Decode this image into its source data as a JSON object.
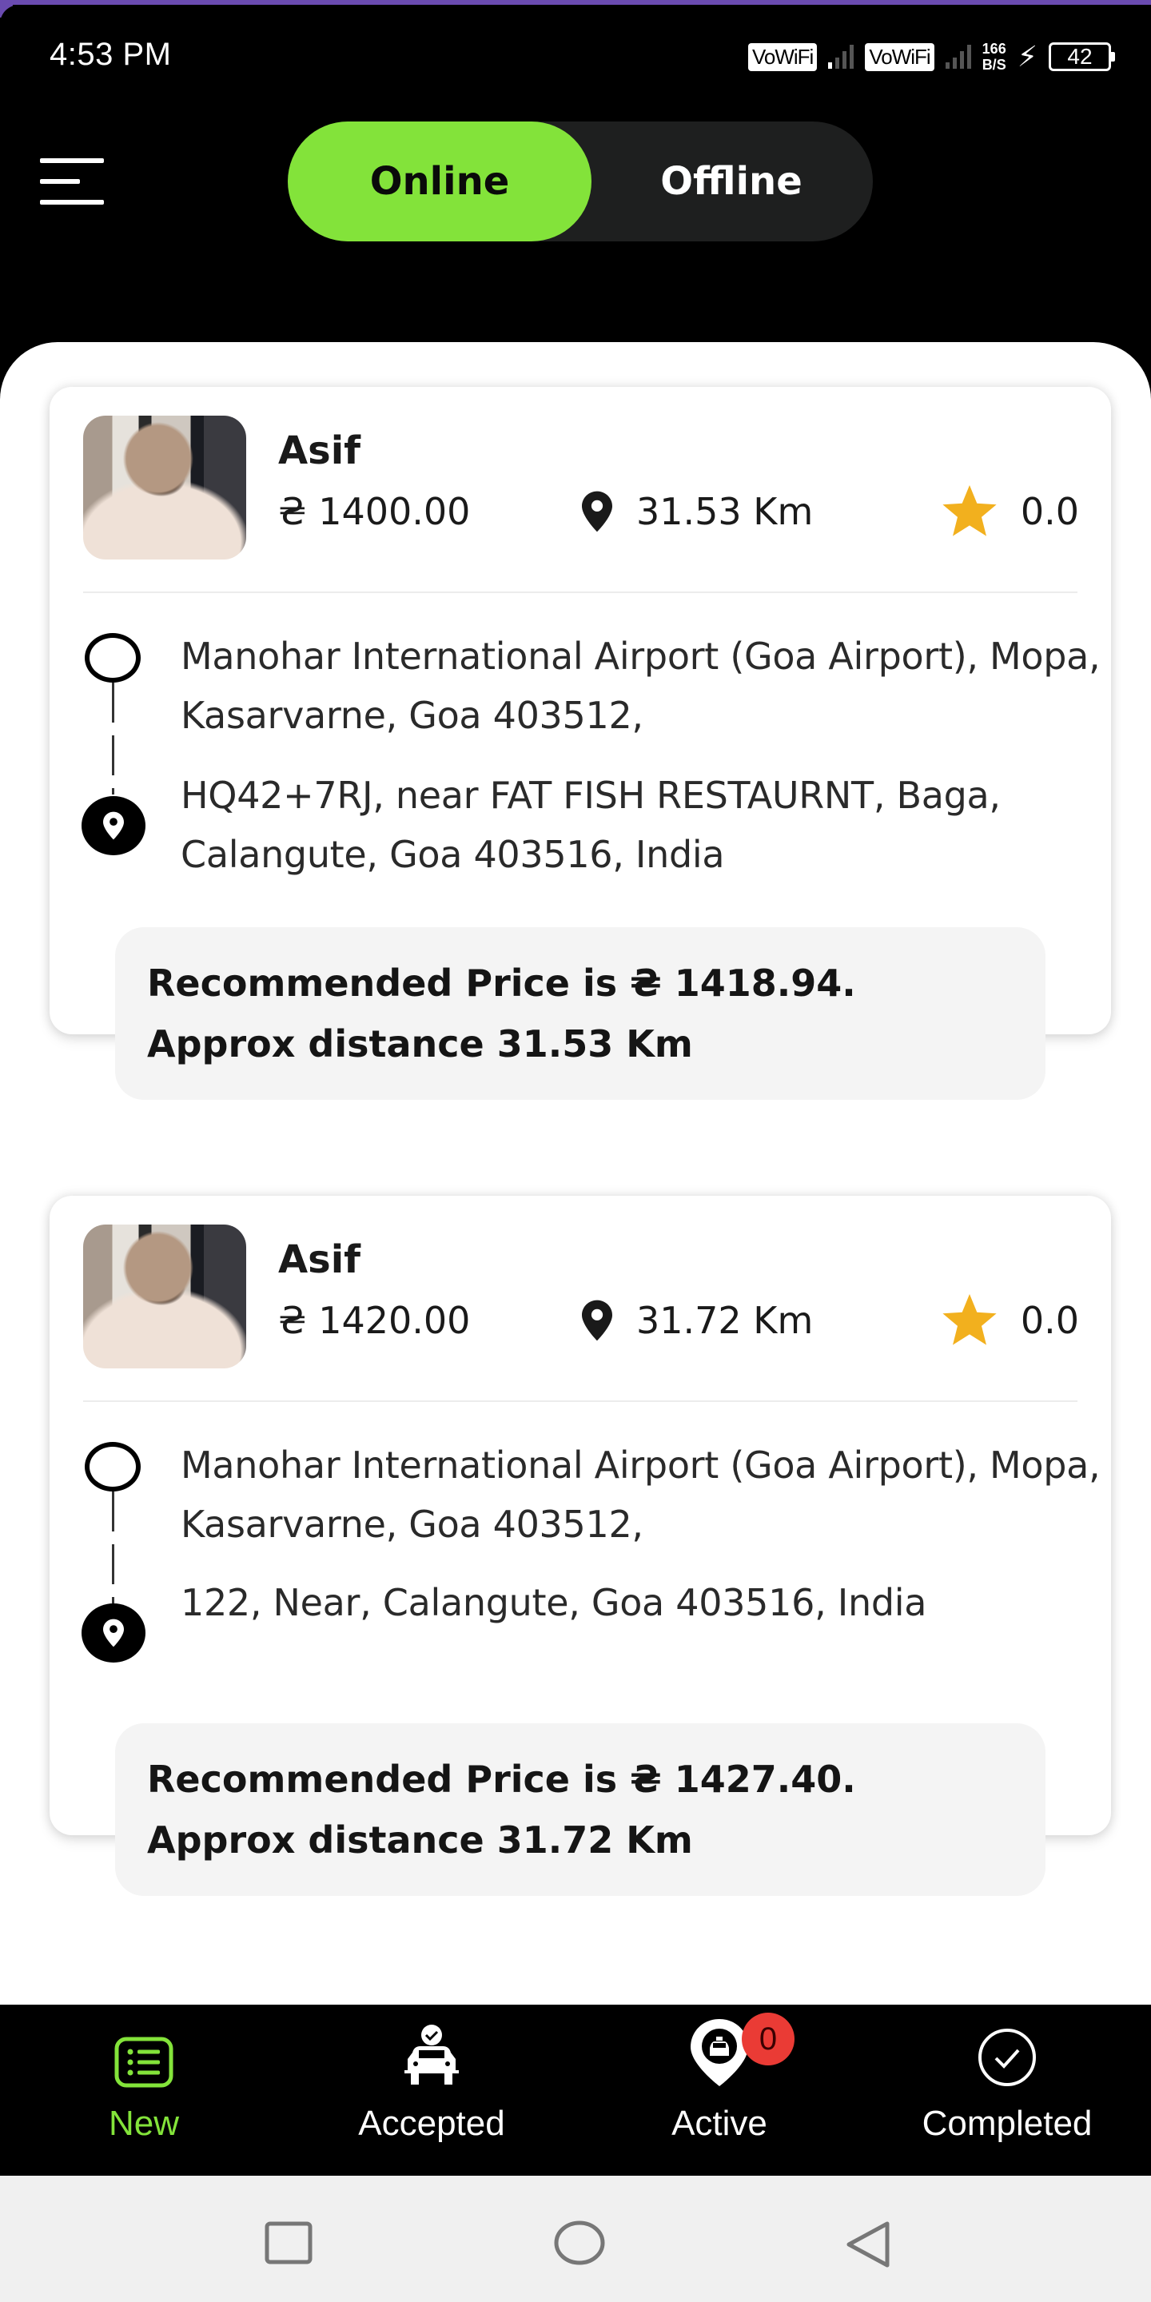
{
  "status_bar": {
    "time": "4:53 PM",
    "network_label_1": "VoWiFi",
    "network_label_2": "VoWiFi",
    "net_speed_value": "166",
    "net_speed_unit": "B/S",
    "battery_level": "42",
    "charging": true
  },
  "header": {
    "menu_icon": "hamburger-menu-icon",
    "status_toggle": {
      "options": [
        "Online",
        "Offline"
      ],
      "selected": "Online"
    }
  },
  "colors": {
    "accent": "#83e33a",
    "badge": "#ea3b35",
    "star": "#f2b01e",
    "header_bg": "#000000",
    "toggle_bg": "#1e1f1f"
  },
  "ride_requests": [
    {
      "rider_name": "Asif",
      "price": "₴ 1400.00",
      "distance": "31.53 Km",
      "rating": "0.0",
      "pickup_address": "Manohar International Airport (Goa Airport), Mopa, Kasarvarne, Goa 403512,",
      "drop_address": "HQ42+7RJ, near FAT FISH RESTAURNT, Baga, Calangute, Goa 403516, India",
      "recommended_line": "Recommended Price is ₴ 1418.94.",
      "approx_line": "Approx distance 31.53 Km"
    },
    {
      "rider_name": "Asif",
      "price": "₴ 1420.00",
      "distance": "31.72 Km",
      "rating": "0.0",
      "pickup_address": "Manohar International Airport (Goa Airport), Mopa, Kasarvarne, Goa 403512,",
      "drop_address": "122, Near, Calangute, Goa 403516, India",
      "recommended_line": "Recommended Price is ₴ 1427.40.",
      "approx_line": "Approx distance 31.72 Km"
    }
  ],
  "bottom_nav": {
    "items": [
      {
        "label": "New",
        "icon": "list-icon",
        "active": true
      },
      {
        "label": "Accepted",
        "icon": "taxi-check-icon",
        "active": false
      },
      {
        "label": "Active",
        "icon": "taxi-pin-icon",
        "active": false,
        "badge": "0"
      },
      {
        "label": "Completed",
        "icon": "check-circle-icon",
        "active": false
      }
    ]
  },
  "system_nav": {
    "buttons": [
      "recents",
      "home",
      "back"
    ]
  }
}
